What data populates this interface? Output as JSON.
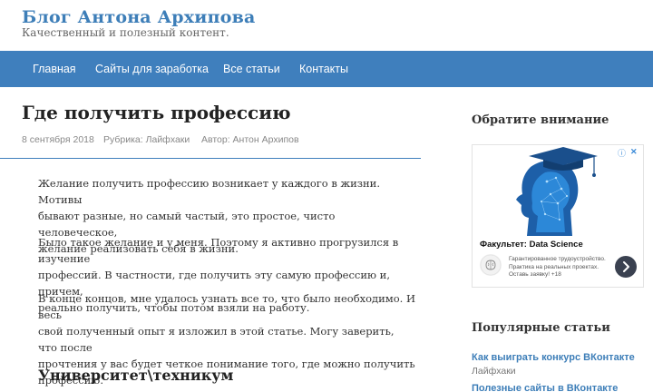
{
  "header": {
    "site_title": "Блог Антона Архипова",
    "site_description": "Качественный и полезный контент."
  },
  "nav": {
    "items": [
      {
        "label": "Главная"
      },
      {
        "label": "Сайты для заработка"
      },
      {
        "label": "Все статьи"
      },
      {
        "label": "Контакты"
      }
    ]
  },
  "post": {
    "title": "Где получить профессию",
    "date": "8 сентября 2018",
    "category": "Рубрика: Лайфхаки",
    "author": "Автор: Антон Архипов",
    "paragraphs": [
      [
        "Желание получить профессию возникает у каждого в жизни. Мотивы",
        "бывают разные, но самый частый, это простое, чисто человеческое,",
        "желание реализовать себя в жизни."
      ],
      [
        "Было такое желание и у меня. Поэтому я активно прогрузился в изучение",
        "профессий. В частности, где получить эту самую профессию и, причем,",
        "реально получить, чтобы потом взяли на работу."
      ],
      [
        "В конце концов, мне удалось узнать все то, что было необходимо. И весь",
        "свой полученный опыт я изложил в этой статье. Могу заверить, что после",
        "прочтения у вас будет четкое понимание того, где можно получить",
        "профессию."
      ]
    ],
    "section_heading": "Университет\\техникум"
  },
  "sidebar": {
    "attention_title": "Обратите внимание",
    "ad": {
      "headline": "Факультет: Data Science",
      "text": [
        "Гарантированное трудоустройство.",
        "Практика на реальных проектах.",
        "Оставь заявку! +18"
      ],
      "info_icon": "info-icon",
      "close_icon": "close-icon",
      "arrow_icon": "chevron-right-icon"
    },
    "popular_title": "Популярные статьи",
    "popular": [
      {
        "title": "Как выиграть конкурс ВКонтакте",
        "category": "Лайфхаки"
      },
      {
        "title": "Полезные сайты в ВКонтакте",
        "category": ""
      }
    ]
  },
  "colors": {
    "accent": "#3f7fbd",
    "link": "#3d7eb8",
    "ad_arrow": "#3a4150"
  }
}
